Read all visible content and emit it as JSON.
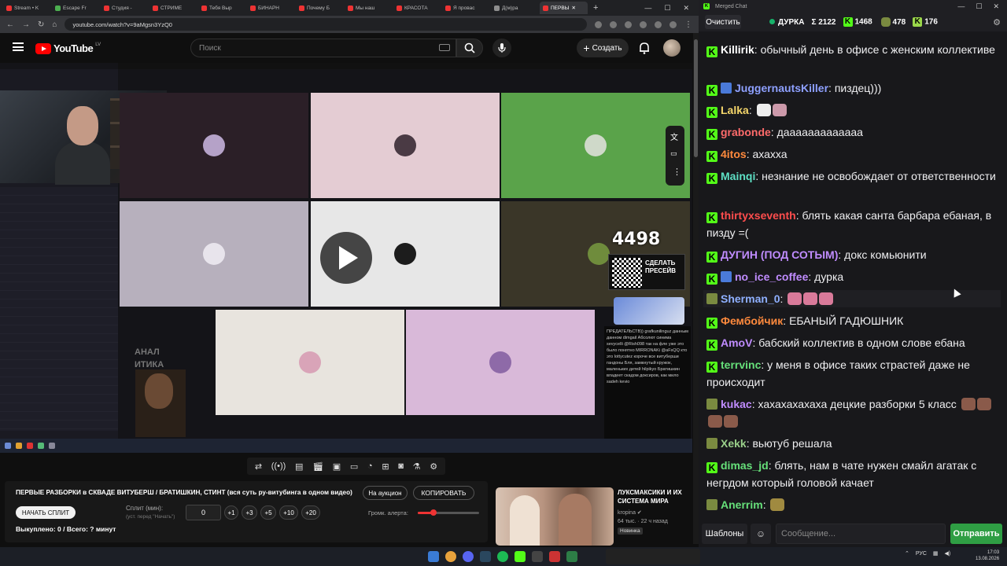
{
  "browser": {
    "tabs": [
      {
        "label": "Stream • K"
      },
      {
        "label": "Escape Fr"
      },
      {
        "label": "Студия -"
      },
      {
        "label": "СТРИМЕ"
      },
      {
        "label": "Тебя Выр"
      },
      {
        "label": "БИНАРН"
      },
      {
        "label": "Почему Б"
      },
      {
        "label": "Мы наш"
      },
      {
        "label": "КРАСОТА"
      },
      {
        "label": "Я провас"
      },
      {
        "label": "Д(м)pa"
      },
      {
        "label": "ПЕРВЫ"
      }
    ],
    "url": "youtube.com/watch?v=9aMgsn3YzQ0"
  },
  "youtube": {
    "logo": "YouTube",
    "region": "LV",
    "search_placeholder": "Поиск",
    "create_label": "Создать"
  },
  "player": {
    "counter": "4498",
    "qr_text": "СДЕЛАТЬ ПРЕСЕЙВ",
    "overlay_label": "АНАЛ ИТИКА",
    "overlay_chat": "ПРЕДАТЕЛЬСТВ)) grafkunilinguz данным данном dimgail Абсолют синима sevycelli @Rish098 так на фле уже это было понятно MIRRONAKi @aFsQQ кто это lottycutez короче все витуберши гандоны Бля, замкнутый кружок, маленьких детей hilpikyo Братишкин владеет скадом доксиров, как мило sadeh kevio"
  },
  "controls": {
    "icons": [
      "loop-icon",
      "radio-icon",
      "subtitles-icon",
      "clapper-icon",
      "pip-icon",
      "theater-icon",
      "speed-icon",
      "add-icon",
      "screenshot-icon",
      "flask-icon",
      "settings-icon"
    ]
  },
  "panel": {
    "video_title": "ПЕРВЫЕ РАЗБОРКИ в СКВАДЕ ВИТУБЕРШ / БРАТИШКИН, СТИНТ (вся суть ру-витубинга в одном видео)",
    "auction_label": "На аукцион",
    "copy_label": "КОПИРОВАТЬ",
    "start_label": "НАЧАТЬ СПЛИТ",
    "split_label": "Сплит (мин):",
    "split_hint": "(уст. перед \"Начать\")",
    "split_value": "0",
    "increments": [
      "+1",
      "+3",
      "+5",
      "+10",
      "+20"
    ],
    "alert_label": "Громк. алерта:",
    "alert_volume": 0.25,
    "bought": "Выкуплено: 0 / Всего: ? минут"
  },
  "recommendation": {
    "title": "ЛУКСМАКСИКИ И ИХ СИСТЕМА МИРА",
    "channel": "kropina",
    "views": "64 тыс.",
    "age": "22 ч назад",
    "badge": "Новинка"
  },
  "merged_chat": {
    "window_title": "Merged Chat",
    "clear_label": "Очистить",
    "channel": "ДУРКА",
    "total": "Σ 2122",
    "kick_count": "1468",
    "twitch_count": "478",
    "other_count": "176",
    "templates_label": "Шаблоны",
    "input_placeholder": "Сообщение...",
    "send_label": "Отправить",
    "messages": [
      {
        "platform": "kick",
        "user": "Killirik",
        "color": "#ffffff",
        "text": "обычный день в офисе с женским коллективе"
      },
      {
        "platform": "kick",
        "user": "JuggernautsKiller",
        "color": "#8ea0ff",
        "text": "пиздец)))"
      },
      {
        "platform": "kick",
        "user": "Lalka",
        "color": "#f5d66b",
        "text": ""
      },
      {
        "platform": "kick",
        "user": "grabonde",
        "color": "#ff6b6b",
        "text": "дааааааааааааа"
      },
      {
        "platform": "kick",
        "user": "4itos",
        "color": "#ff8a3d",
        "text": "ахахха"
      },
      {
        "platform": "kick",
        "user": "Mainqi",
        "color": "#5ee0c5",
        "text": "незнание не освобождает от ответственности"
      },
      {
        "platform": "kick",
        "user": "thirtyxseventh",
        "color": "#ff4d4d",
        "text": "блять какая санта барбара ебаная, в пизду =("
      },
      {
        "platform": "kick",
        "user": "ДУГИН (ПОД СОТЫМ)",
        "color": "#c08cff",
        "text": "докс комьюнити"
      },
      {
        "platform": "kick",
        "user": "no_ice_coffee",
        "color": "#c08cff",
        "text": "дурка"
      },
      {
        "platform": "yt",
        "user": "Sherman_0",
        "color": "#8fb0ff",
        "text": ""
      },
      {
        "platform": "kick",
        "user": "Фембойчик",
        "color": "#ff8a3d",
        "text": "ЕБАНЫЙ ГАДЮШНИК"
      },
      {
        "platform": "kick",
        "user": "AmoV",
        "color": "#c08cff",
        "text": "бабский коллектив в одном слове ебана"
      },
      {
        "platform": "kick",
        "user": "terrvinc",
        "color": "#66e07a",
        "text": "у меня в офисе таких страстей даже не происходит"
      },
      {
        "platform": "yt",
        "user": "kukac",
        "color": "#c08cff",
        "text": "хахахахахаха децкие разборки 5 класс"
      },
      {
        "platform": "yt",
        "user": "Xekk",
        "color": "#9ad08a",
        "text": "вьютуб решала"
      },
      {
        "platform": "kick",
        "user": "dimas_jd",
        "color": "#66e07a",
        "text": "блять, нам в чате нужен смайл агатак с негрдом который головой качает"
      },
      {
        "platform": "yt",
        "user": "Anerrim",
        "color": "#66e07a",
        "text": ""
      }
    ]
  },
  "taskbar": {
    "lang": "РУС",
    "time": "17:03",
    "date": "13.08.2026"
  }
}
